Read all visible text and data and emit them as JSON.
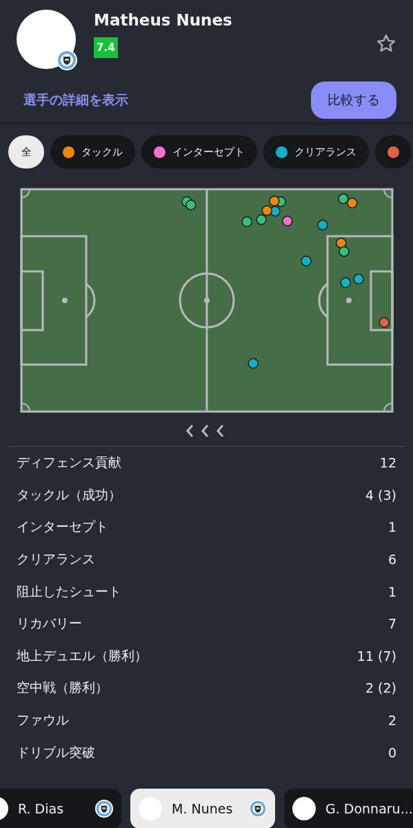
{
  "player": {
    "name": "Matheus Nunes",
    "rating": "7.4",
    "favorite": false
  },
  "details_link": "選手の詳細を表示",
  "compare_button": "比較する",
  "filters": [
    {
      "label": "全",
      "selected": true
    },
    {
      "label": "タックル",
      "color": "#f0860f",
      "selected": false
    },
    {
      "label": "インターセプト",
      "color": "#f472c8",
      "selected": false
    },
    {
      "label": "クリアランス",
      "color": "#14b0c8",
      "selected": false
    },
    {
      "color": "#e0604c",
      "selected": false
    }
  ],
  "events": [
    {
      "color": "#3dbd7d"
    },
    {
      "color": "#3dbd7d"
    },
    {
      "color": "#3dbd7d"
    },
    {
      "color": "#f0860f"
    },
    {
      "color": "#14b0c8"
    },
    {
      "color": "#f0860f"
    },
    {
      "color": "#3dbd7d"
    },
    {
      "color": "#3dbd7d"
    },
    {
      "color": "#f472c8"
    },
    {
      "color": "#14b0c8"
    },
    {
      "color": "#3dbd7d"
    },
    {
      "color": "#f0860f"
    },
    {
      "color": "#f0860f"
    },
    {
      "color": "#3dbd7d"
    },
    {
      "color": "#14b0c8"
    },
    {
      "color": "#14b0c8"
    },
    {
      "color": "#14b0c8"
    },
    {
      "color": "#e0604c"
    },
    {
      "color": "#14b0c8"
    }
  ],
  "stats": [
    {
      "label": "ディフェンス貢献",
      "value": "12"
    },
    {
      "label": "タックル（成功）",
      "value": "4 (3)"
    },
    {
      "label": "インターセプト",
      "value": "1"
    },
    {
      "label": "クリアランス",
      "value": "6"
    },
    {
      "label": "阻止したシュート",
      "value": "1"
    },
    {
      "label": "リカバリー",
      "value": "7"
    },
    {
      "label": "地上デュエル（勝利）",
      "value": "11 (7)"
    },
    {
      "label": "空中戦（勝利）",
      "value": "2 (2)"
    },
    {
      "label": "ファウル",
      "value": "2"
    },
    {
      "label": "ドリブル突破",
      "value": "0"
    }
  ],
  "player_tabs": [
    {
      "name": "R. Dias",
      "selected": false,
      "badge": true
    },
    {
      "name": "M. Nunes",
      "selected": true,
      "badge": true
    },
    {
      "name": "G. Donnaru...",
      "selected": false,
      "badge": false
    }
  ]
}
